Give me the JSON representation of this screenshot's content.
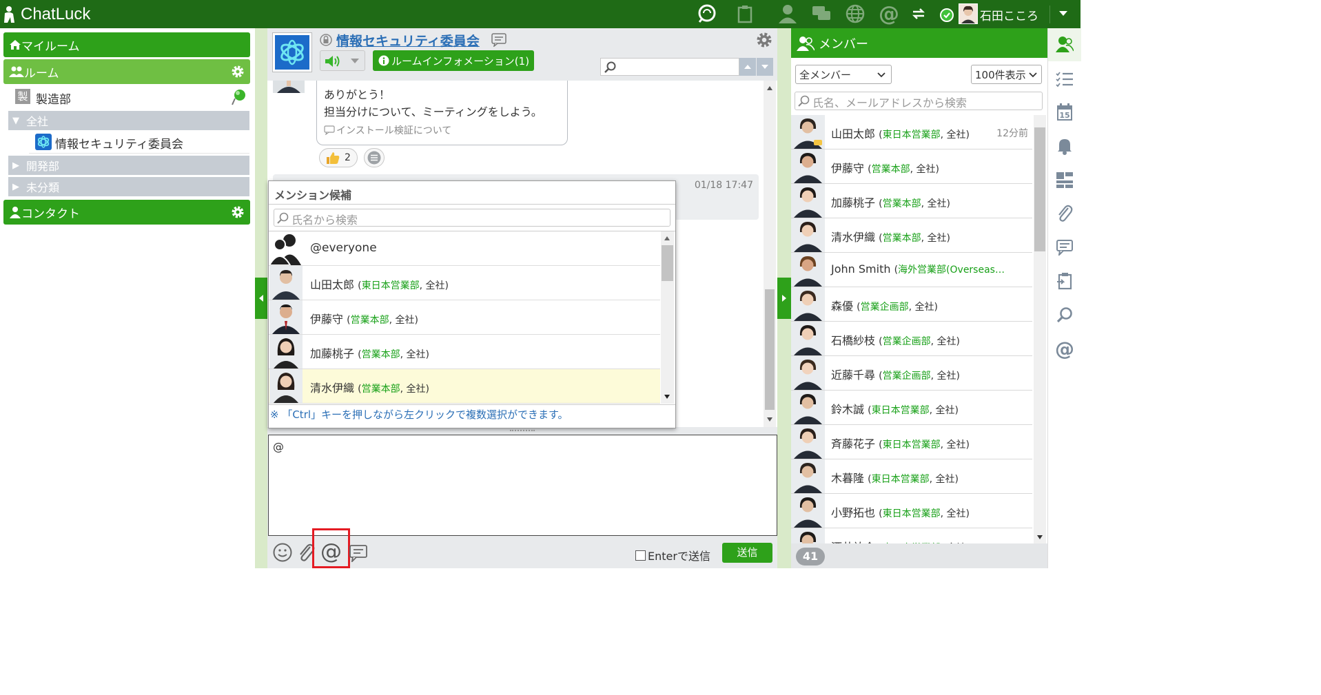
{
  "header": {
    "app_name": "ChatLuck",
    "user_name": "石田こころ"
  },
  "left": {
    "my_room": "マイルーム",
    "rooms": "ルーム",
    "dept_badge": "製",
    "dept_name": "製造部",
    "group_all": "全社",
    "room_selected": "情報セキュリティ委員会",
    "group_dev": "開発部",
    "group_uncat": "未分類",
    "contacts": "コンタクト"
  },
  "room": {
    "title": "情報セキュリティ委員会",
    "info_button": "ルームインフォメーション(1)",
    "search_placeholder": ""
  },
  "messages": [
    {
      "line1": "ありがとう！",
      "line2": "担当分けについて、ミーティングをしよう。",
      "thread": "インストール検証について",
      "reaction_count": "2"
    },
    {
      "timestamp": "01/18 17:47"
    }
  ],
  "mention": {
    "title": "メンション候補",
    "search_placeholder": "氏名から検索",
    "everyone": "@everyone",
    "candidates": [
      {
        "name": "山田太郎",
        "dept": "東日本営業部",
        "company": "全社"
      },
      {
        "name": "伊藤守",
        "dept": "営業本部",
        "company": "全社"
      },
      {
        "name": "加藤桃子",
        "dept": "営業本部",
        "company": "全社"
      },
      {
        "name": "清水伊織",
        "dept": "営業本部",
        "company": "全社"
      }
    ],
    "hint": "※ 「Ctrl」キーを押しながら左クリックで複数選択ができます。"
  },
  "composer": {
    "text": "@",
    "enter_send": "Enterで送信",
    "send": "送信"
  },
  "members": {
    "title": "メンバー",
    "filter": "全メンバー",
    "per_page": "100件表示",
    "search_placeholder": "氏名、メールアドレスから検索",
    "count": "41",
    "list": [
      {
        "name": "山田太郎",
        "dept": "東日本営業部",
        "company": "全社",
        "time": "12分前"
      },
      {
        "name": "伊藤守",
        "dept": "営業本部",
        "company": "全社"
      },
      {
        "name": "加藤桃子",
        "dept": "営業本部",
        "company": "全社"
      },
      {
        "name": "清水伊織",
        "dept": "営業本部",
        "company": "全社"
      },
      {
        "name": "John Smith",
        "dept": "海外営業部(Overseas…",
        "company": ""
      },
      {
        "name": "森優",
        "dept": "営業企画部",
        "company": "全社"
      },
      {
        "name": "石橋紗枝",
        "dept": "営業企画部",
        "company": "全社"
      },
      {
        "name": "近藤千尋",
        "dept": "営業企画部",
        "company": "全社"
      },
      {
        "name": "鈴木誠",
        "dept": "東日本営業部",
        "company": "全社"
      },
      {
        "name": "斉藤花子",
        "dept": "東日本営業部",
        "company": "全社"
      },
      {
        "name": "木暮隆",
        "dept": "東日本営業部",
        "company": "全社"
      },
      {
        "name": "小野拓也",
        "dept": "東日本営業部",
        "company": "全社"
      },
      {
        "name": "酒井祐介",
        "dept": "東日本営業部",
        "company": "全社"
      }
    ]
  },
  "colors": {
    "brand_dark": "#1f6b16",
    "brand": "#2ea11a",
    "brand_light": "#6fbf43",
    "dept_text": "#17a017",
    "highlight": "#fdfbd9"
  }
}
